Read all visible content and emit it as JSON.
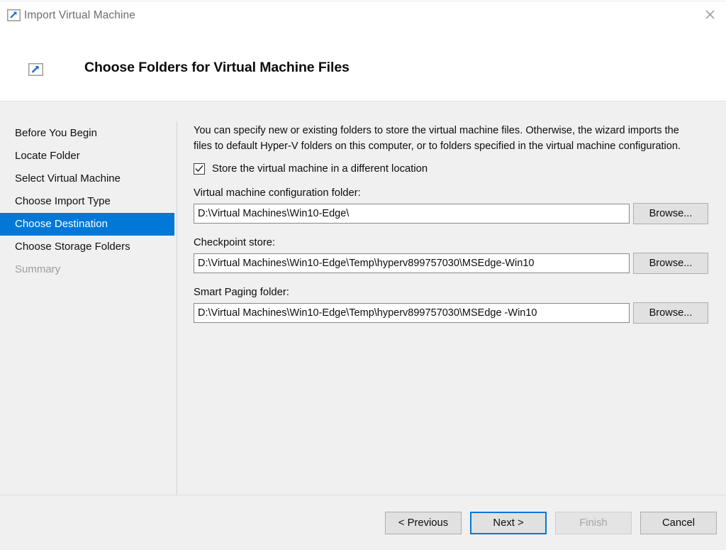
{
  "window": {
    "title": "Import Virtual Machine",
    "title_icon": "import-vm-icon",
    "close_icon": "close-icon"
  },
  "header": {
    "icon": "import-vm-icon",
    "title": "Choose Folders for Virtual Machine Files"
  },
  "steps": [
    {
      "label": "Before You Begin",
      "state": "visited"
    },
    {
      "label": "Locate Folder",
      "state": "visited"
    },
    {
      "label": "Select Virtual Machine",
      "state": "visited"
    },
    {
      "label": "Choose Import Type",
      "state": "visited"
    },
    {
      "label": "Choose Destination",
      "state": "active"
    },
    {
      "label": "Choose Storage Folders",
      "state": "visited"
    },
    {
      "label": "Summary",
      "state": "disabled"
    }
  ],
  "content": {
    "intro": "You can specify new or existing folders to store the virtual machine files. Otherwise, the wizard imports the files to default Hyper-V folders on this computer, or to folders specified in the virtual machine configuration.",
    "checkbox": {
      "label": "Store the virtual machine in a different location",
      "checked": true
    },
    "fields": [
      {
        "label": "Virtual machine configuration folder:",
        "value": "D:\\Virtual Machines\\Win10-Edge\\",
        "browse_label": "Browse..."
      },
      {
        "label": "Checkpoint store:",
        "value": "D:\\Virtual Machines\\Win10-Edge\\Temp\\hyperv899757030\\MSEdge-Win10",
        "browse_label": "Browse..."
      },
      {
        "label": "Smart Paging folder:",
        "value": "D:\\Virtual Machines\\Win10-Edge\\Temp\\hyperv899757030\\MSEdge -Win10",
        "browse_label": "Browse..."
      }
    ]
  },
  "footer": {
    "previous_label": "< Previous",
    "next_label": "Next >",
    "finish_label": "Finish",
    "cancel_label": "Cancel"
  },
  "colors": {
    "accent": "#0078d7",
    "body_background": "#f0f0f0",
    "panel_background": "#ffffff",
    "disabled_text": "#9d9d9d"
  }
}
